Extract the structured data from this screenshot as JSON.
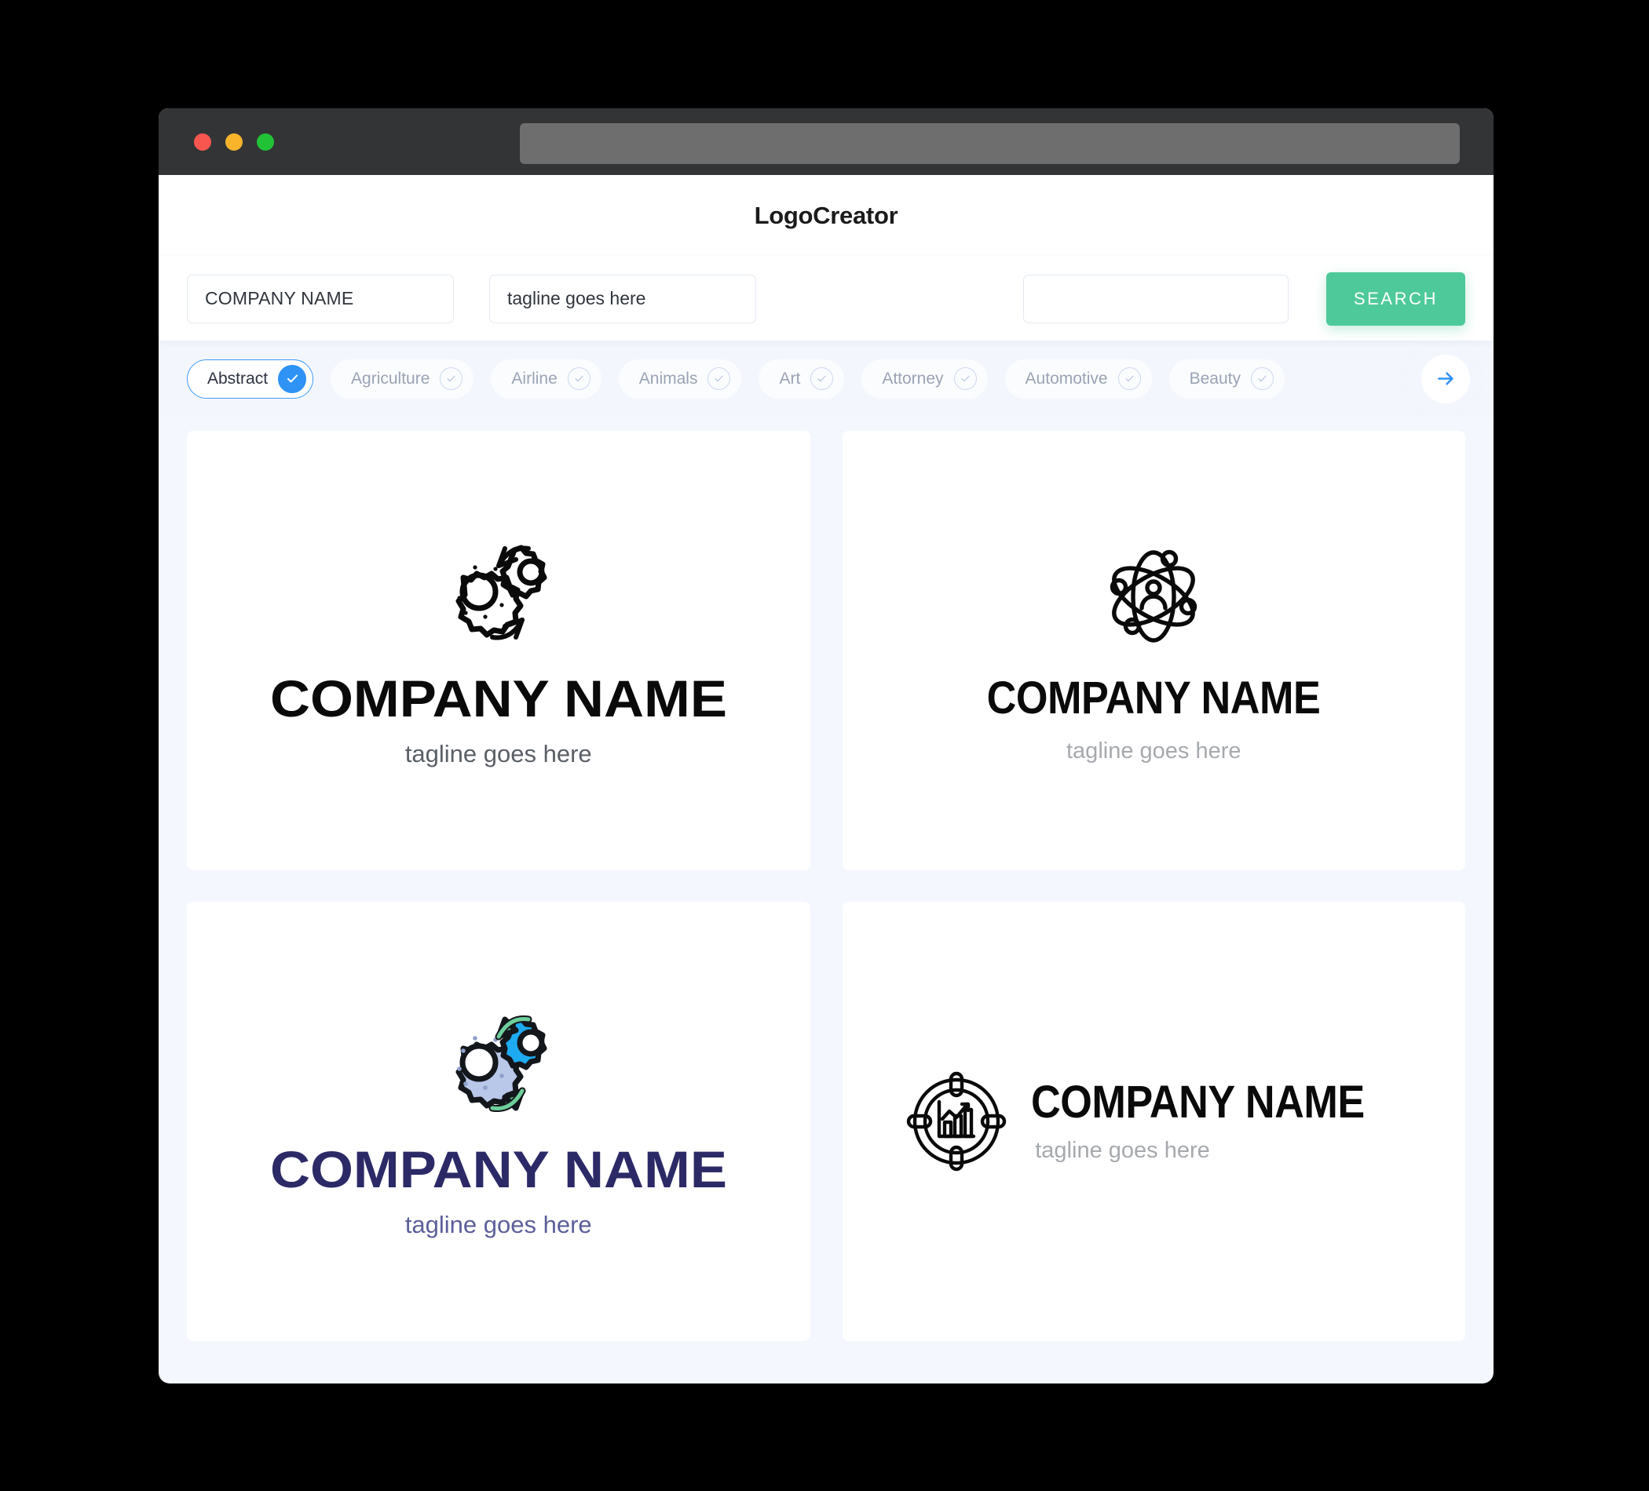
{
  "window": {
    "traffic_lights": [
      {
        "name": "close",
        "color": "#f9564f"
      },
      {
        "name": "minimize",
        "color": "#f9b42b"
      },
      {
        "name": "maximize",
        "color": "#22c236"
      }
    ],
    "url_value": ""
  },
  "header": {
    "title": "LogoCreator"
  },
  "search": {
    "company_value": "COMPANY NAME",
    "company_placeholder": "COMPANY NAME",
    "tagline_value": "tagline goes here",
    "tagline_placeholder": "tagline goes here",
    "extra_value": "",
    "extra_placeholder": "",
    "button_label": "SEARCH",
    "button_color": "#4ec99a"
  },
  "categories": {
    "next_icon": "arrow-right-icon",
    "accent_color": "#2f92f5",
    "items": [
      {
        "label": "Abstract",
        "selected": true
      },
      {
        "label": "Agriculture",
        "selected": false
      },
      {
        "label": "Airline",
        "selected": false
      },
      {
        "label": "Animals",
        "selected": false
      },
      {
        "label": "Art",
        "selected": false
      },
      {
        "label": "Attorney",
        "selected": false
      },
      {
        "label": "Automotive",
        "selected": false
      },
      {
        "label": "Beauty",
        "selected": false
      }
    ]
  },
  "results": [
    {
      "id": "logo-gears-mono",
      "icon": "gears-rotation-icon",
      "name": "COMPANY NAME",
      "tagline": "tagline goes here",
      "name_color": "#0a0a0a",
      "tagline_color": "#5a5f66",
      "layout": "stacked"
    },
    {
      "id": "logo-atom-person",
      "icon": "atom-person-icon",
      "name": "COMPANY NAME",
      "tagline": "tagline goes here",
      "name_color": "#0a0a0a",
      "tagline_color": "#a6a9ad",
      "layout": "stacked"
    },
    {
      "id": "logo-gears-color",
      "icon": "gears-rotation-color-icon",
      "name": "COMPANY NAME",
      "tagline": "tagline goes here",
      "name_color": "#2c2a66",
      "tagline_color": "#5c5f9a",
      "layout": "stacked"
    },
    {
      "id": "logo-target-chart",
      "icon": "target-bar-chart-icon",
      "name": "COMPANY NAME",
      "tagline": "tagline goes here",
      "name_color": "#0a0a0a",
      "tagline_color": "#a6a9ad",
      "layout": "horizontal"
    }
  ]
}
